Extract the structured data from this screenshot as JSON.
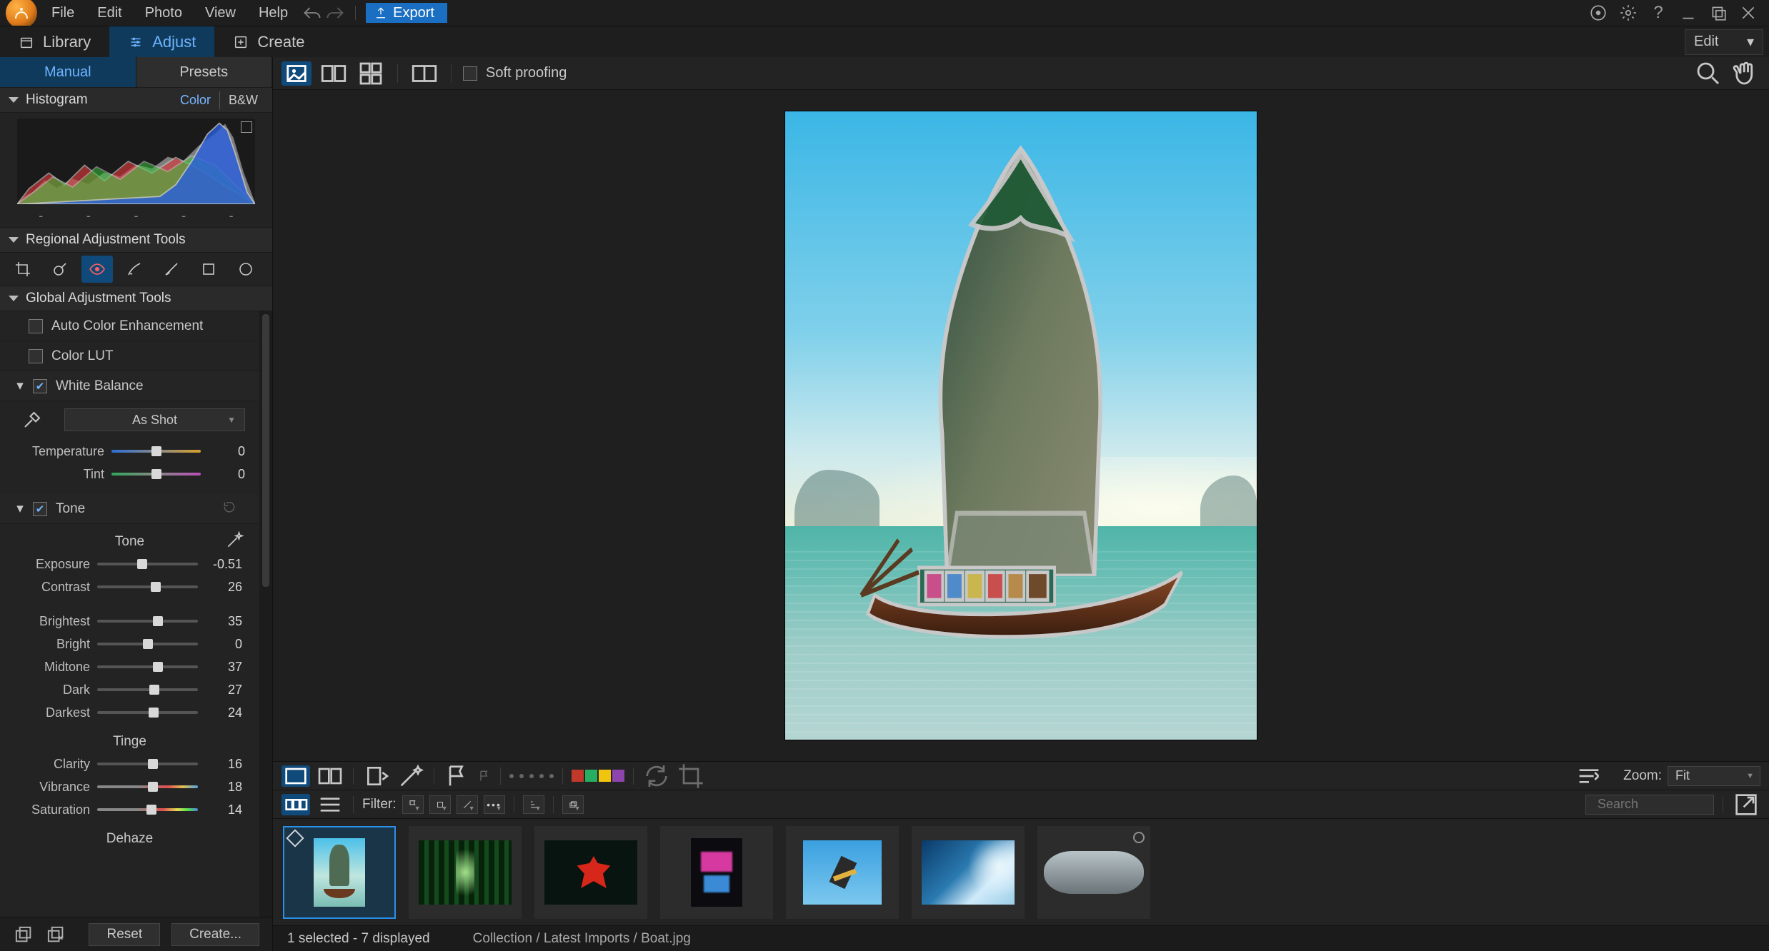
{
  "menu": {
    "items": [
      "File",
      "Edit",
      "Photo",
      "View",
      "Help"
    ],
    "export": "Export"
  },
  "modebar": {
    "library": "Library",
    "adjust": "Adjust",
    "create": "Create",
    "edit_drop": "Edit"
  },
  "leftpanel": {
    "tabs": {
      "manual": "Manual",
      "presets": "Presets"
    },
    "histogram": {
      "title": "Histogram",
      "color": "Color",
      "bw": "B&W",
      "dashes": [
        "-",
        "-",
        "-",
        "-",
        "-"
      ]
    },
    "regional": {
      "title": "Regional Adjustment Tools"
    },
    "global": {
      "title": "Global Adjustment Tools",
      "auto_color": "Auto Color Enhancement",
      "color_lut": "Color LUT",
      "white_balance": "White Balance",
      "wb_mode": "As Shot",
      "wb_sliders": [
        {
          "label": "Temperature",
          "value": "0",
          "pos": 50,
          "class": "temp"
        },
        {
          "label": "Tint",
          "value": "0",
          "pos": 50,
          "class": "tint"
        }
      ],
      "tone_title": "Tone",
      "tone_header": "Tone",
      "tone_sliders1": [
        {
          "label": "Exposure",
          "value": "-0.51",
          "pos": 45,
          "class": "gray"
        },
        {
          "label": "Contrast",
          "value": "26",
          "pos": 58,
          "class": "gray"
        }
      ],
      "tone_sliders2": [
        {
          "label": "Brightest",
          "value": "35",
          "pos": 60,
          "class": "gray"
        },
        {
          "label": "Bright",
          "value": "0",
          "pos": 50,
          "class": "gray"
        },
        {
          "label": "Midtone",
          "value": "37",
          "pos": 60,
          "class": "gray"
        },
        {
          "label": "Dark",
          "value": "27",
          "pos": 57,
          "class": "gray"
        },
        {
          "label": "Darkest",
          "value": "24",
          "pos": 56,
          "class": "gray"
        }
      ],
      "tinge_header": "Tinge",
      "tinge_sliders": [
        {
          "label": "Clarity",
          "value": "16",
          "pos": 55,
          "class": "gray"
        },
        {
          "label": "Vibrance",
          "value": "18",
          "pos": 55,
          "class": "vib"
        },
        {
          "label": "Saturation",
          "value": "14",
          "pos": 54,
          "class": "sat"
        }
      ],
      "dehaze": "Dehaze"
    },
    "footer": {
      "reset": "Reset",
      "create": "Create..."
    }
  },
  "viewtoolbar": {
    "soft_proofing": "Soft proofing"
  },
  "fbar1": {
    "swatches": [
      "#c0392b",
      "#27ae60",
      "#f1c40f",
      "#8e44ad"
    ],
    "zoom_label": "Zoom:",
    "zoom_value": "Fit"
  },
  "fbar2": {
    "filter_label": "Filter:",
    "search_placeholder": "Search"
  },
  "status": {
    "selection": "1 selected - 7 displayed",
    "breadcrumb": "Collection / Latest Imports / Boat.jpg"
  }
}
